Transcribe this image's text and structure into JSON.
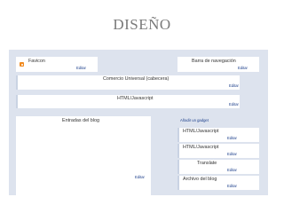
{
  "slide": {
    "title": "DISEÑO"
  },
  "layout_editor": {
    "favicon": {
      "label": "Favicon",
      "edit": "Editar"
    },
    "navbar": {
      "label": "Barra de navegación",
      "edit": "Editar"
    },
    "header": {
      "label": "Comercio Universal (cabecera)",
      "edit": "Editar"
    },
    "html1": {
      "label": "HTML/Javascript",
      "edit": "Editar"
    },
    "posts": {
      "label": "Entradas del blog",
      "edit": "Editar"
    },
    "add_gadget": "Añadir un gadget",
    "sidebar": [
      {
        "label": "HTML/Javascript",
        "edit": "Editar"
      },
      {
        "label": "HTML/Javascript",
        "edit": "Editar"
      },
      {
        "label": "Translate",
        "edit": "Editar"
      },
      {
        "label": "Archivo del blog",
        "edit": "Editar"
      }
    ]
  }
}
